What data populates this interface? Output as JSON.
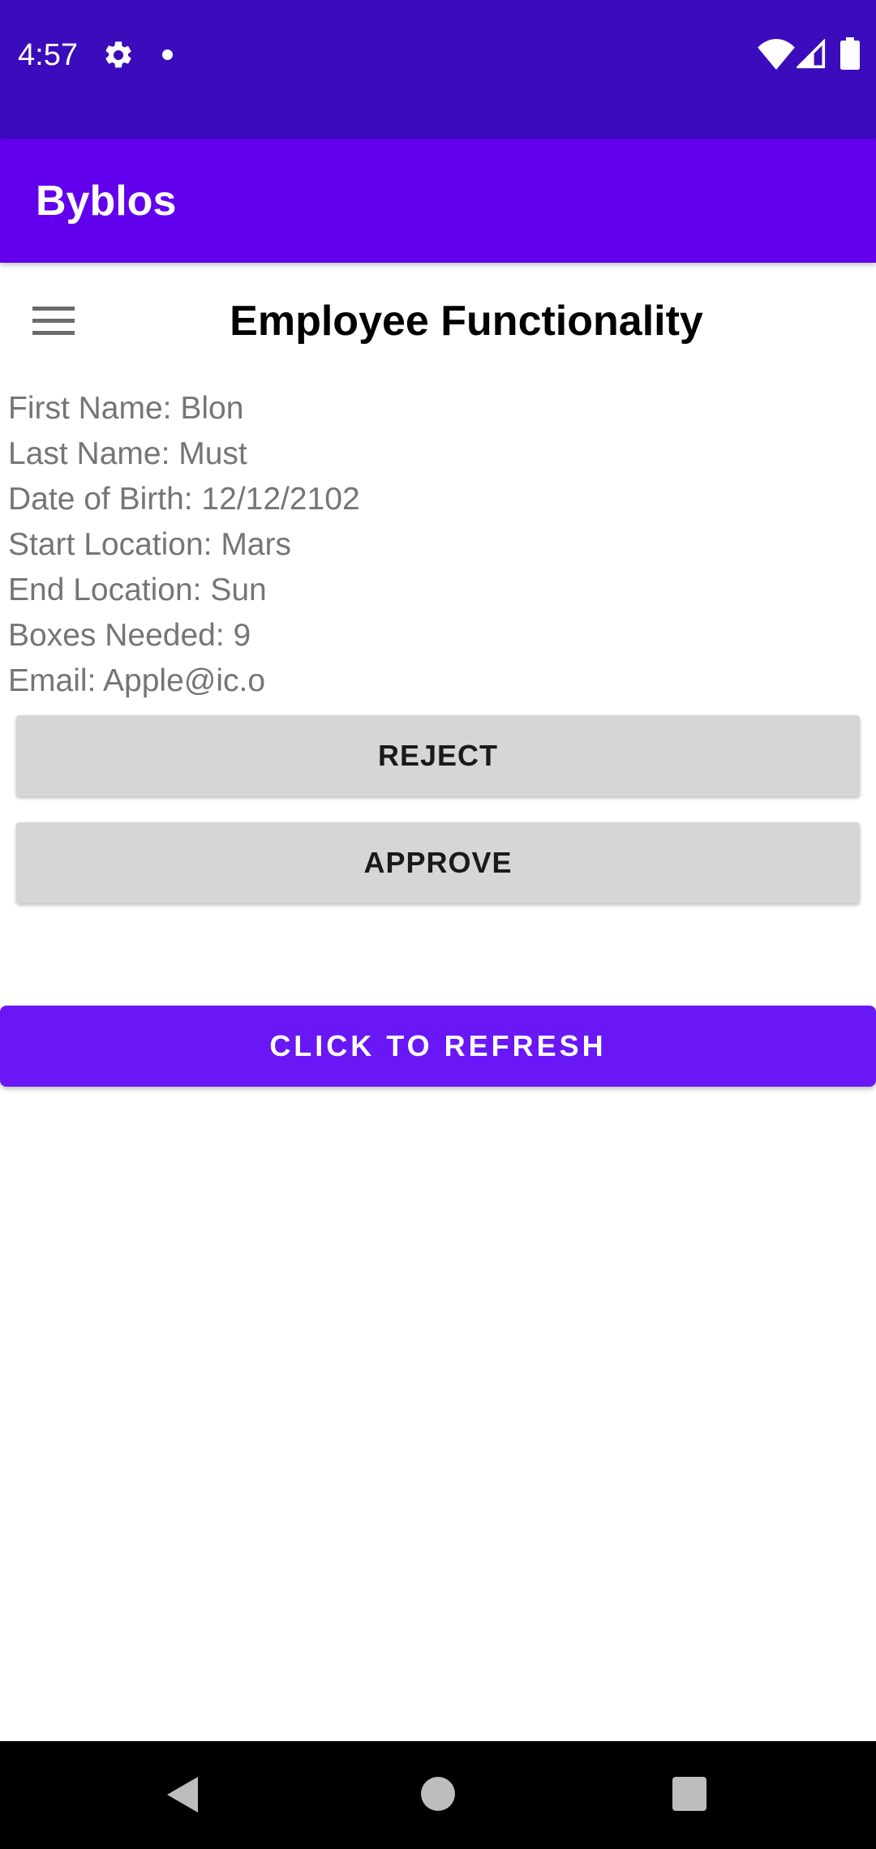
{
  "status_bar": {
    "time": "4:57",
    "icons": [
      "gear-icon",
      "notification-dot-icon",
      "wifi-icon",
      "signal-icon",
      "battery-icon"
    ]
  },
  "app_bar": {
    "title": "Byblos"
  },
  "page": {
    "title": "Employee Functionality",
    "details": [
      "First Name: Blon",
      "Last Name: Must",
      "Date of Birth: 12/12/2102",
      "Start Location: Mars",
      "End Location: Sun",
      "Boxes Needed: 9",
      "Email: Apple@ic.o"
    ]
  },
  "buttons": {
    "reject": "REJECT",
    "approve": "APPROVE",
    "refresh": "CLICK TO REFRESH"
  },
  "nav_bar": {
    "icons": [
      "back-icon",
      "home-icon",
      "recents-icon"
    ]
  },
  "colors": {
    "status_bar": "#3a0cbb",
    "app_bar": "#6200ee",
    "refresh_button": "#6917f5",
    "gray_button": "#d6d6d6",
    "detail_text": "#757575"
  }
}
